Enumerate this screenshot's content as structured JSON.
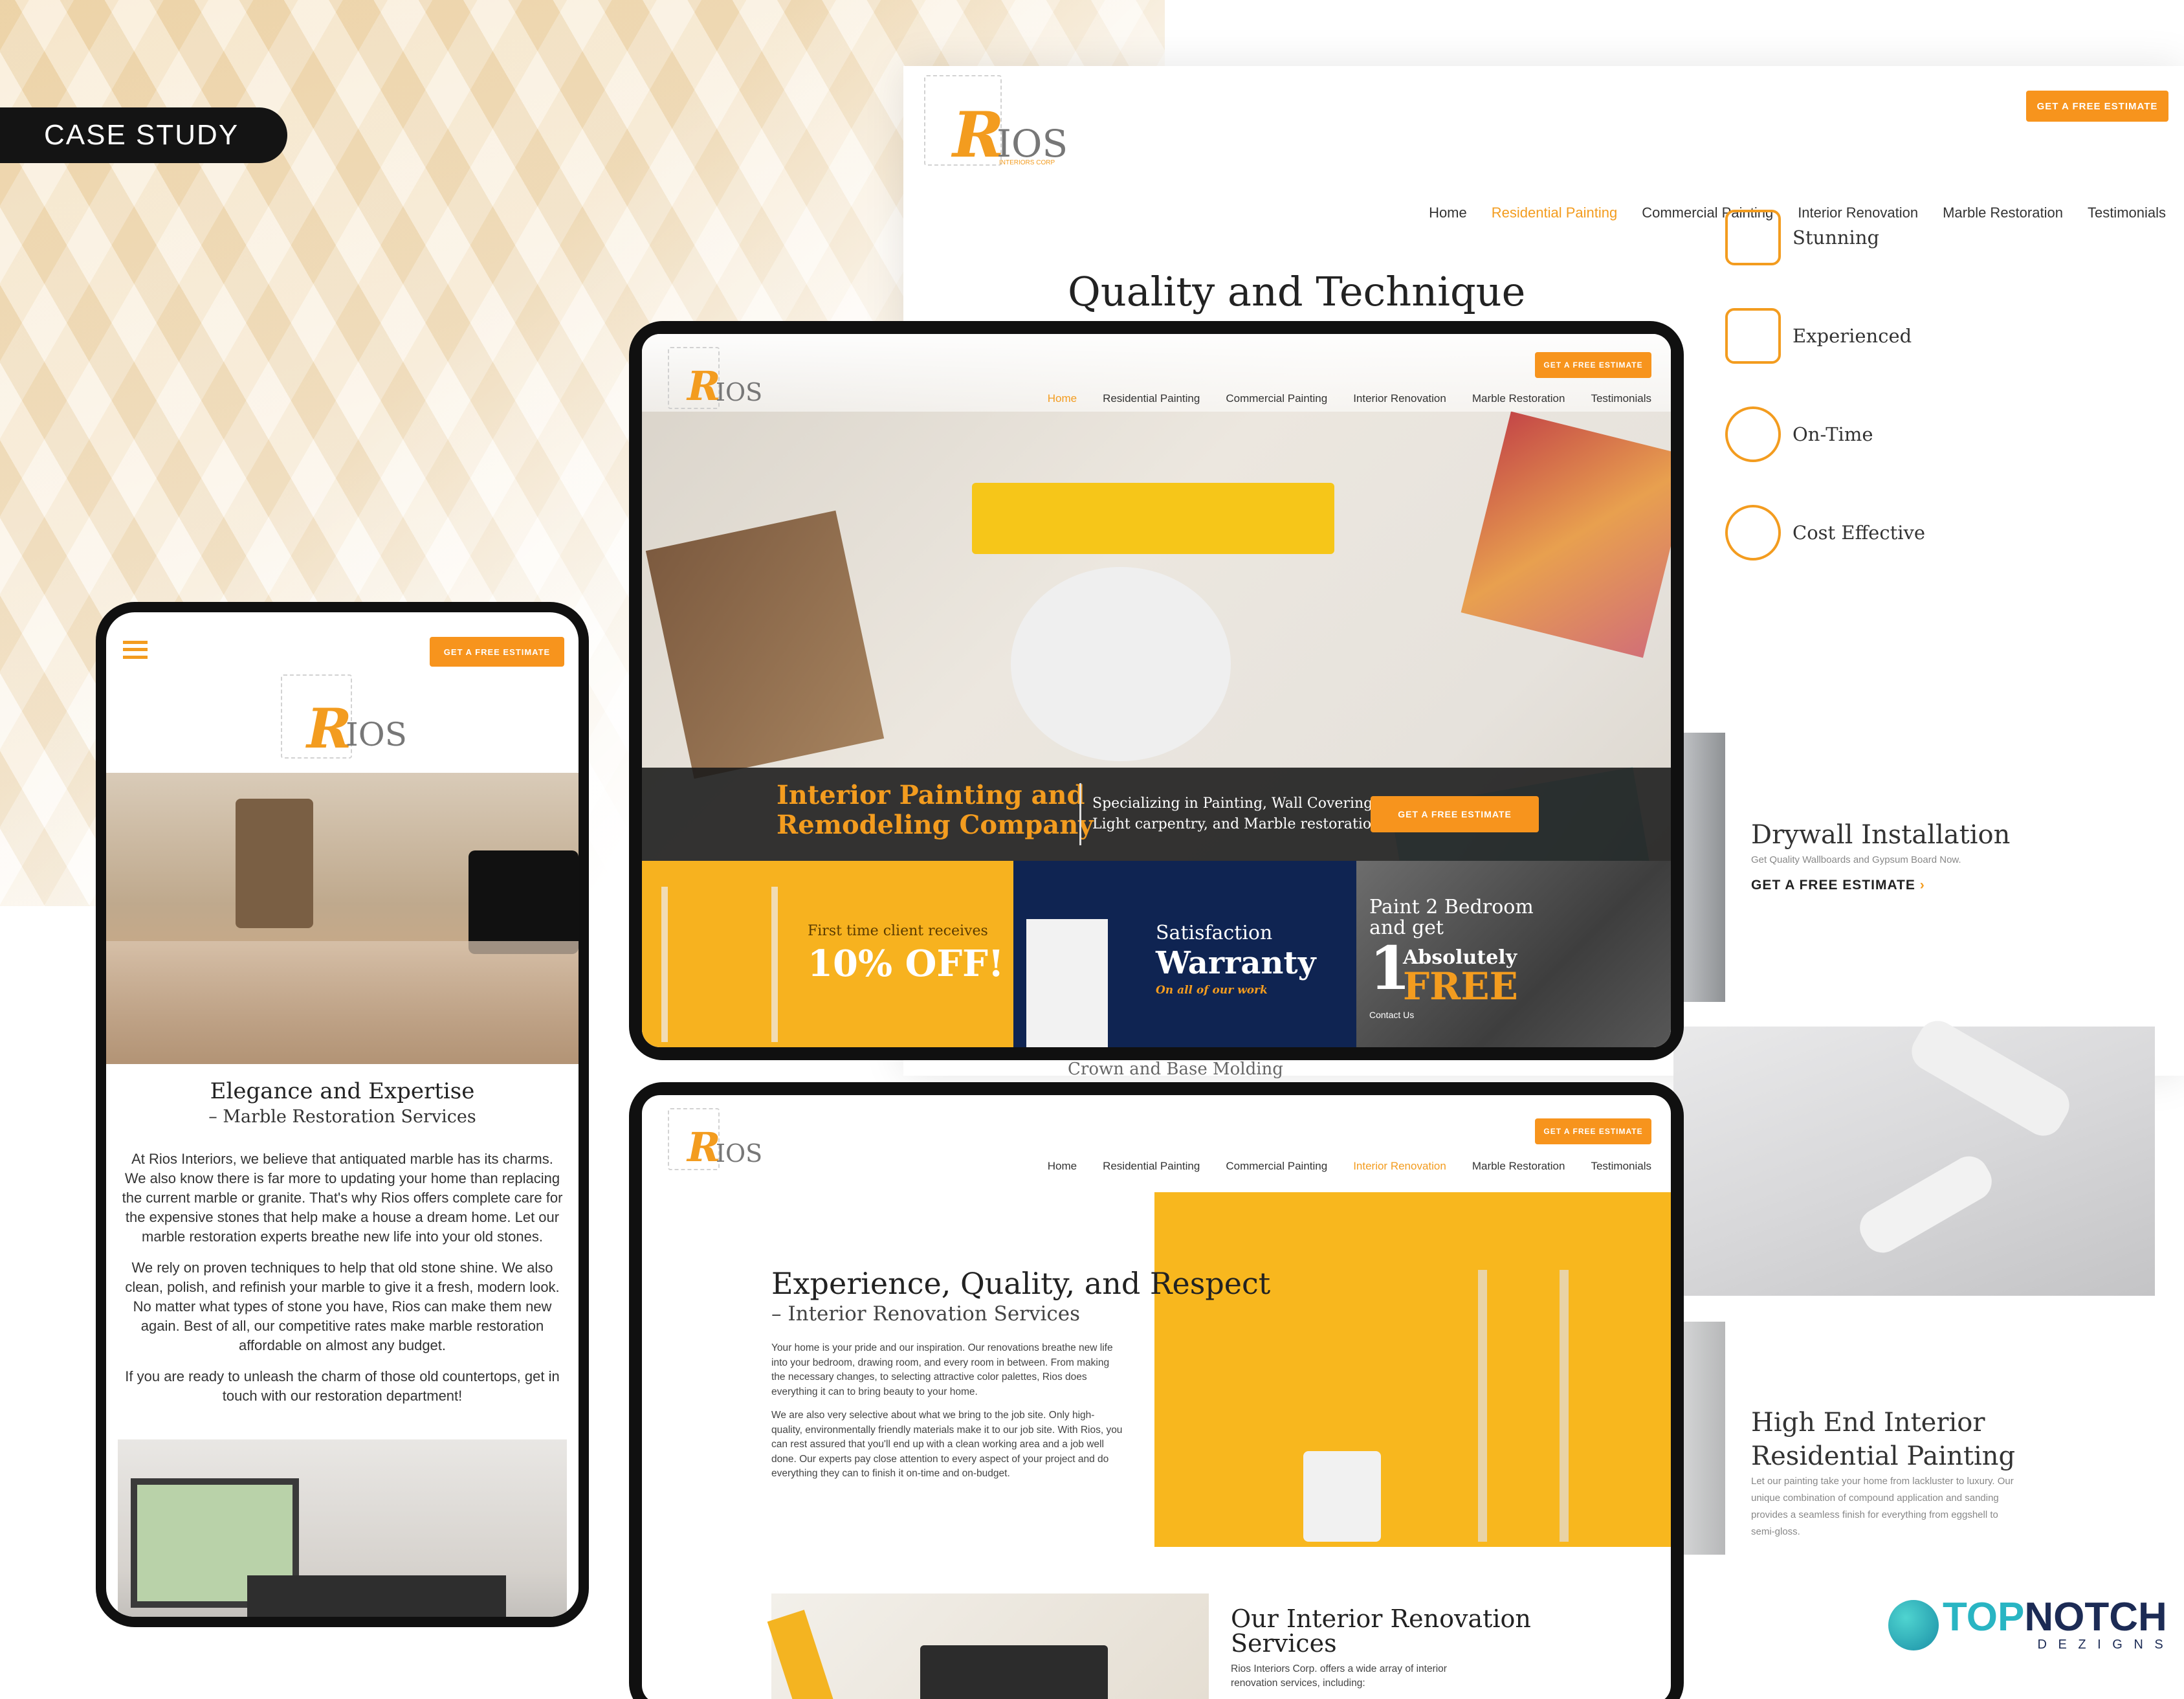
{
  "case_label": "CASE STUDY",
  "brand": {
    "logo_r": "R",
    "logo_ios": "IOS",
    "logo_sub": "INTERIORS CORP",
    "cta": "GET A FREE ESTIMATE"
  },
  "nav": [
    "Home",
    "Residential Painting",
    "Commercial Painting",
    "Interior Renovation",
    "Marble Restoration",
    "Testimonials"
  ],
  "desktop": {
    "heading": "Quality and Technique",
    "features": [
      "Stunning",
      "Experienced",
      "On-Time",
      "Cost Effective"
    ],
    "service1": {
      "title": "Drywall Installation",
      "desc": "Get Quality Wallboards and Gypsum Board Now.",
      "link": "GET A FREE ESTIMATE"
    },
    "service2": {
      "title_line1": "High End Interior",
      "title_line2": "Residential Painting",
      "desc": "Let our painting take your home from lackluster to luxury. Our unique combination of compound application and sanding provides a seamless finish for everything from eggshell to semi-gloss."
    },
    "crown": "Crown and Base Molding"
  },
  "tablet1": {
    "hero_title_line1": "Interior Painting and",
    "hero_title_line2": "Remodeling Company",
    "hero_sub_line1": "Specializing in Painting, Wall Covering,",
    "hero_sub_line2": "Light carpentry, and Marble restoration.",
    "promo1": {
      "top": "First time client receives",
      "big": "10% OFF!"
    },
    "promo2": {
      "top": "Satisfaction",
      "big": "Warranty",
      "sub": "On all of our work"
    },
    "promo3": {
      "top_line1": "Paint 2 Bedroom",
      "top_line2": "and get",
      "num": "1",
      "big1": "Absolutely",
      "big2": "FREE",
      "sub": "Contact Us"
    }
  },
  "tablet2": {
    "heading": "Experience, Quality, and Respect",
    "subheading": "– Interior Renovation Services",
    "para1": "Your home is your pride and our inspiration. Our renovations breathe new life into your bedroom, drawing room, and every room in between. From making the necessary changes, to selecting attractive color palettes, Rios does everything it can to bring beauty to your home.",
    "para2": "We are also very selective about what we bring to the job site. Only high-quality, environmentally friendly materials make it to our job site. With Rios, you can rest assured that you'll end up with a clean working area and a job well done. Our experts pay close attention to every aspect of your project and do everything they can to finish it on-time and on-budget.",
    "services_title_line1": "Our Interior Renovation",
    "services_title_line2": "Services",
    "services_desc_line1": "Rios Interiors Corp. offers a wide array of interior",
    "services_desc_line2": "renovation services, including:"
  },
  "phone": {
    "heading": "Elegance and Expertise",
    "subheading": "– Marble Restoration Services",
    "para1": "At Rios Interiors, we believe that antiquated marble has its charms. We also know there is far more to updating your home than replacing the current marble or granite. That's why Rios offers complete care for the expensive stones that help make a house a dream home. Let our marble restoration experts breathe new life into your old stones.",
    "para2": "We rely on proven techniques to help that old stone shine. We also clean, polish, and refinish your marble to give it a fresh, modern look. No matter what types of stone you have, Rios can make them new again. Best of all, our competitive rates make marble restoration affordable on almost any budget.",
    "para3": "If you are ready to unleash the charm of those old countertops, get in touch with our restoration department!"
  },
  "footer_brand": {
    "top": "TOP",
    "notch": "NOTCH",
    "sub": "D E Z I G N S"
  },
  "colors": {
    "accent": "#f7941d",
    "dark": "#141414"
  }
}
